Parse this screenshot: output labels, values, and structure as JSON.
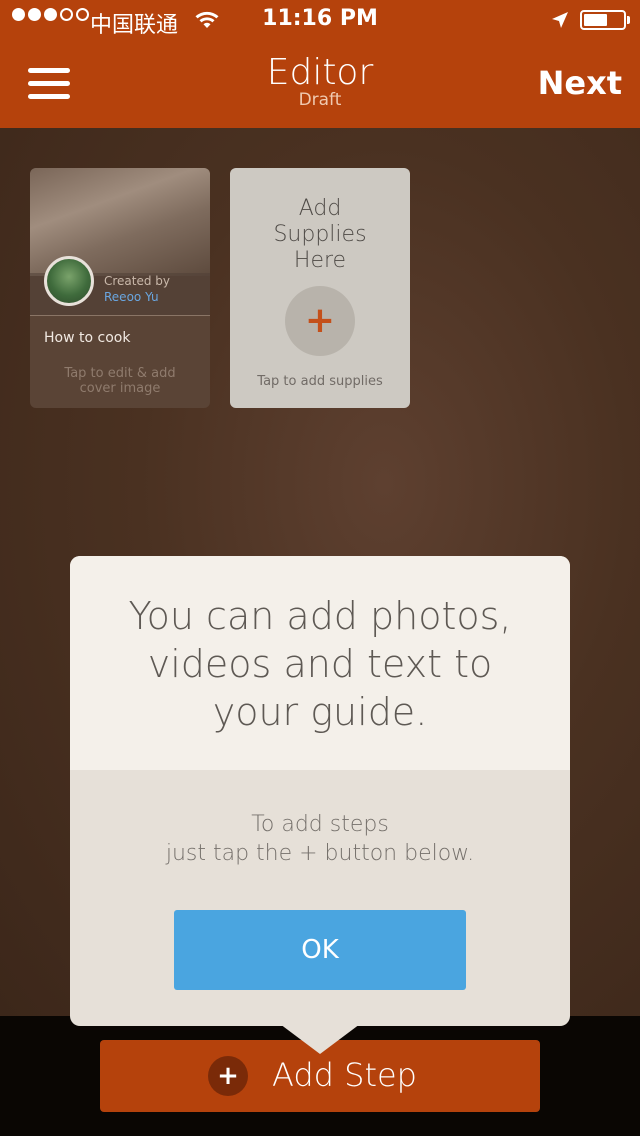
{
  "status_bar": {
    "carrier": "中国联通",
    "time": "11:16 PM",
    "signal_bars_filled": 3,
    "signal_bars_total": 5,
    "battery_level": 0.6
  },
  "header": {
    "title": "Editor",
    "subtitle": "Draft",
    "next_label": "Next"
  },
  "cover_card": {
    "created_by_label": "Created by",
    "author": "Reeoo Yu",
    "guide_title": "How to cook",
    "hint_line1": "Tap to edit & add",
    "hint_line2": "cover image"
  },
  "supplies_card": {
    "title_line1": "Add",
    "title_line2": "Supplies",
    "title_line3": "Here",
    "add_symbol": "+",
    "hint": "Tap to add supplies"
  },
  "tooltip": {
    "headline_line1": "You can add photos,",
    "headline_line2": "videos and text to",
    "headline_line3": "your guide.",
    "body_line1": "To add steps",
    "body_line2": "just tap the + button below.",
    "ok_label": "OK"
  },
  "add_step": {
    "icon_symbol": "+",
    "label": "Add Step"
  },
  "colors": {
    "brand": "#b5420c",
    "link": "#6aa6e0",
    "ok_button": "#4aa5e0"
  },
  "icons": [
    "menu-icon",
    "wifi-icon",
    "location-arrow-icon",
    "battery-icon",
    "plus-icon"
  ]
}
